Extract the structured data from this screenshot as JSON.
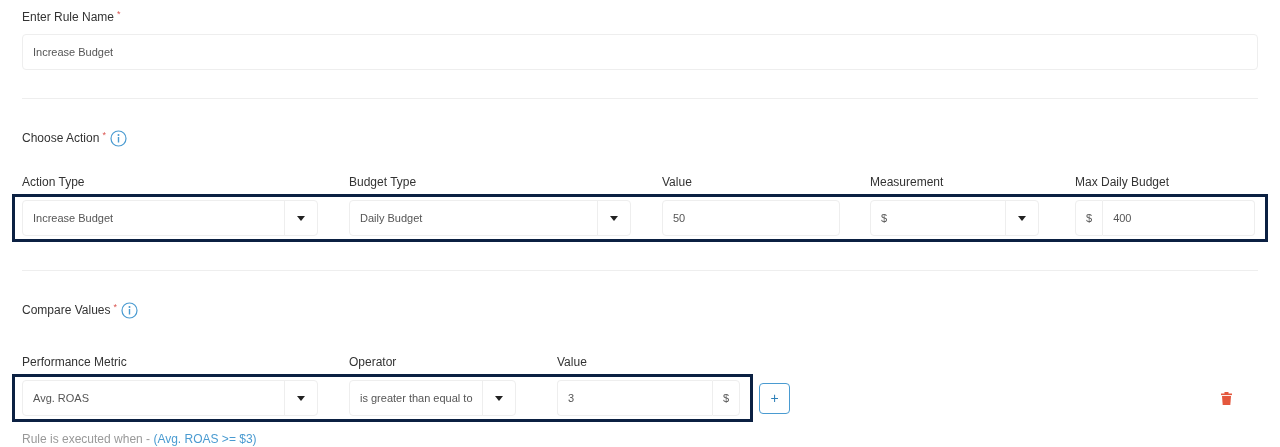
{
  "rule_name": {
    "label": "Enter Rule Name",
    "required_mark": "*",
    "value": "Increase Budget"
  },
  "choose_action": {
    "title": "Choose Action",
    "required_mark": "*",
    "highlighted": true,
    "fields": [
      {
        "kind": "select",
        "label": "Action Type",
        "value": "Increase Budget"
      },
      {
        "kind": "select",
        "label": "Budget Type",
        "value": "Daily Budget"
      },
      {
        "kind": "input",
        "label": "Value",
        "value": "50"
      },
      {
        "kind": "select",
        "label": "Measurement",
        "value": "$"
      },
      {
        "kind": "prefix",
        "label": "Max Daily Budget",
        "addon": "$",
        "value": "400"
      }
    ]
  },
  "compare_values": {
    "title": "Compare Values",
    "required_mark": "*",
    "highlighted": true,
    "fields": [
      {
        "kind": "select",
        "label": "Performance Metric",
        "value": "Avg. ROAS"
      },
      {
        "kind": "select",
        "label": "Operator",
        "value": "is greater than equal to"
      },
      {
        "kind": "suffix",
        "label": "Value",
        "addon": "$",
        "value": "3"
      }
    ],
    "add_button": "+",
    "summary": {
      "text": "Rule is executed when - ",
      "condition": "(Avg. ROAS >= $3)"
    }
  }
}
